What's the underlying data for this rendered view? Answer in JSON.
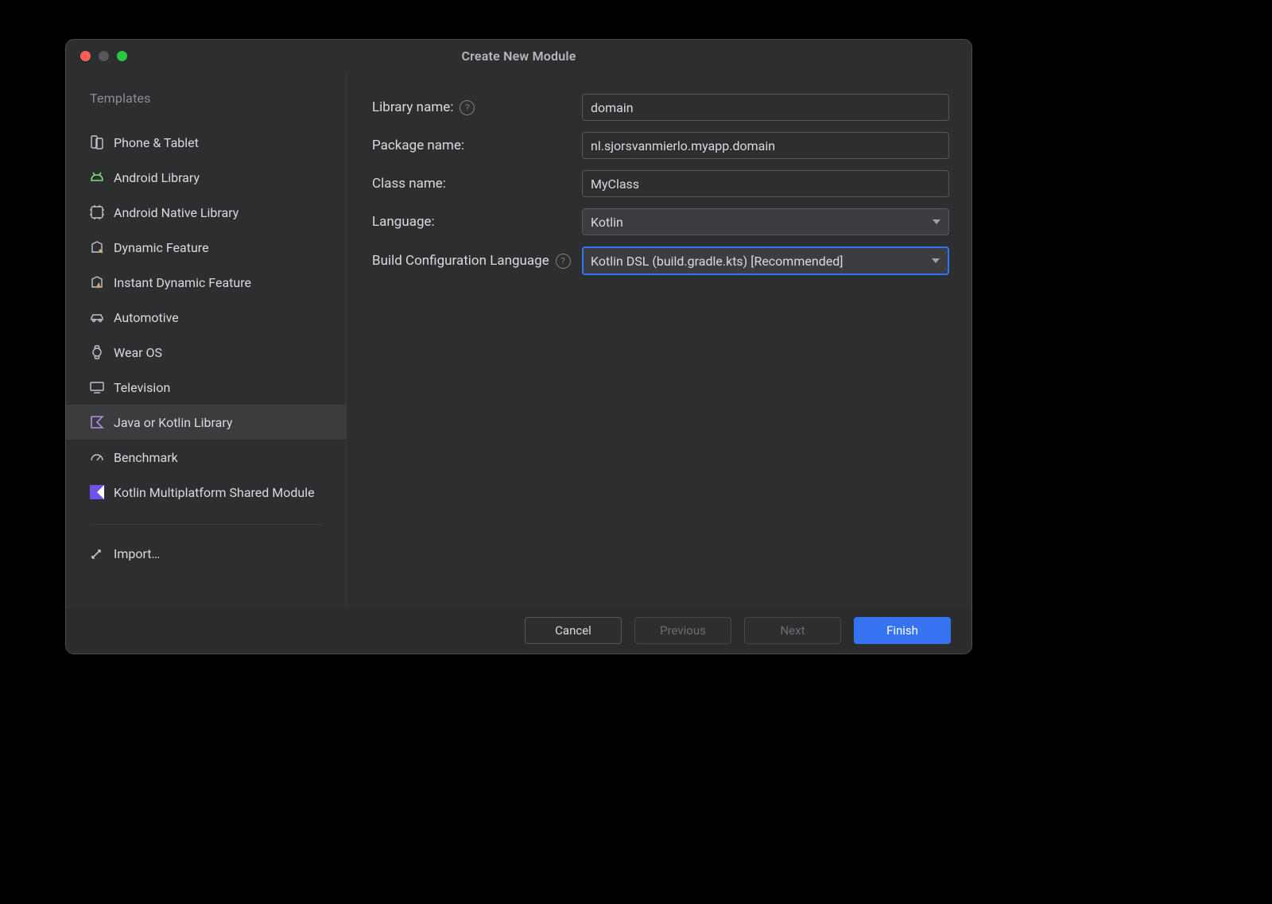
{
  "title": "Create New Module",
  "sidebar": {
    "heading": "Templates",
    "import_label": "Import…",
    "items": [
      {
        "label": "Phone & Tablet",
        "icon": "phone-tablet-icon",
        "selected": false
      },
      {
        "label": "Android Library",
        "icon": "android-icon",
        "selected": false
      },
      {
        "label": "Android Native Library",
        "icon": "native-lib-icon",
        "selected": false
      },
      {
        "label": "Dynamic Feature",
        "icon": "dynamic-feature-icon",
        "selected": false
      },
      {
        "label": "Instant Dynamic Feature",
        "icon": "instant-feature-icon",
        "selected": false
      },
      {
        "label": "Automotive",
        "icon": "car-icon",
        "selected": false
      },
      {
        "label": "Wear OS",
        "icon": "watch-icon",
        "selected": false
      },
      {
        "label": "Television",
        "icon": "tv-icon",
        "selected": false
      },
      {
        "label": "Java or Kotlin Library",
        "icon": "kotlin-lib-icon",
        "selected": true
      },
      {
        "label": "Benchmark",
        "icon": "gauge-icon",
        "selected": false
      },
      {
        "label": "Kotlin Multiplatform Shared Module",
        "icon": "kmp-icon",
        "selected": false
      }
    ]
  },
  "form": {
    "library_name": {
      "label": "Library name:",
      "value": "domain",
      "help": "?"
    },
    "package_name": {
      "label": "Package name:",
      "value": "nl.sjorsvanmierlo.myapp.domain"
    },
    "class_name": {
      "label": "Class name:",
      "value": "MyClass"
    },
    "language": {
      "label": "Language:",
      "value": "Kotlin"
    },
    "build_lang": {
      "label": "Build Configuration Language",
      "help": "?",
      "value": "Kotlin DSL (build.gradle.kts) [Recommended]"
    }
  },
  "footer": {
    "cancel": "Cancel",
    "previous": "Previous",
    "next": "Next",
    "finish": "Finish"
  },
  "colors": {
    "accent": "#3573f0",
    "android_green": "#7adf79"
  }
}
